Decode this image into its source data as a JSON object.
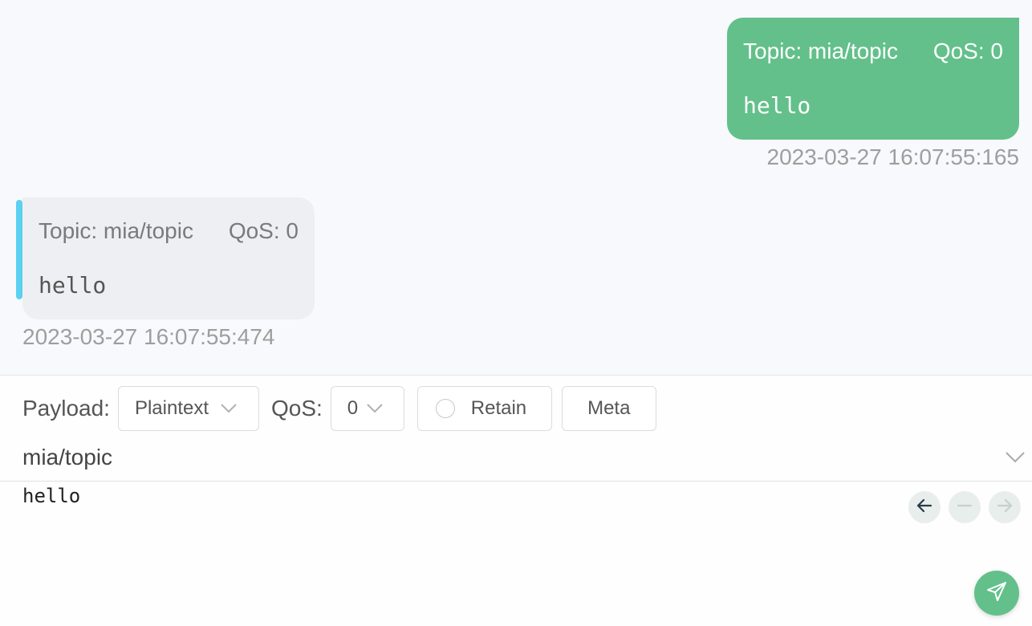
{
  "messages": {
    "sent": {
      "topic": "Topic: mia/topic",
      "qos": "QoS: 0",
      "payload": "hello",
      "time": "2023-03-27 16:07:55:165"
    },
    "received": {
      "topic": "Topic: mia/topic",
      "qos": "QoS: 0",
      "payload": "hello",
      "time": "2023-03-27 16:07:55:474"
    }
  },
  "composer": {
    "payload_label": "Payload:",
    "payload_format": "Plaintext",
    "qos_label": "QoS:",
    "qos_value": "0",
    "retain_label": "Retain",
    "meta_label": "Meta",
    "topic": "mia/topic",
    "payload": "hello"
  },
  "colors": {
    "sent_bubble": "#63c08a",
    "received_accent": "#5bd1f0",
    "received_bubble": "#eeeff2",
    "send_button": "#63c08a"
  },
  "icons": {
    "format_dropdown": "chevron-down-icon",
    "qos_dropdown": "chevron-down-icon",
    "retain": "radio-icon",
    "topic_dropdown": "chevron-down-icon",
    "history_prev": "arrow-left-icon",
    "history_reset": "minus-icon",
    "history_next": "arrow-right-icon",
    "send": "send-icon"
  }
}
